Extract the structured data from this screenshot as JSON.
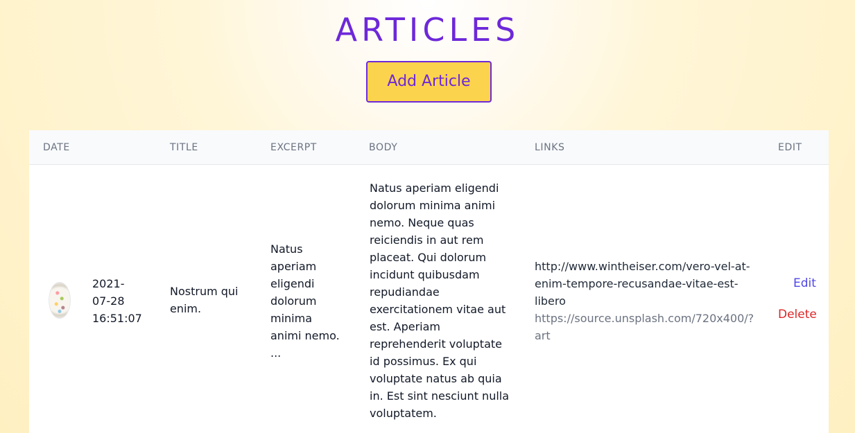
{
  "page": {
    "title": "ARTICLES",
    "add_button": "Add Article"
  },
  "table": {
    "headers": [
      "DATE",
      "TITLE",
      "EXCERPT",
      "BODY",
      "LINKS",
      "EDIT"
    ],
    "rows": [
      {
        "date": "2021-\n07-28\n16:51:07",
        "title": "Nostrum qui\nenim.",
        "excerpt": "Natus\naperiam\neligendi\ndolorum\nminima\nanimi nemo.\n...",
        "body": "Natus aperiam eligendi\ndolorum minima animi\nnemo. Neque quas\nreiciendis in aut rem\nplaceat. Qui dolorum\nincidunt quibusdam\nrepudiandae\nexercitationem vitae aut\nest. Aperiam\nreprehenderit voluptate\nid possimus. Ex qui\nvoluptate natus ab quia\nin. Est sint nesciunt nulla\nvoluptatem.",
        "link_url": "http://www.wintheiser.com/vero-vel-at-\nenim-tempore-recusandae-vitae-est-\nlibero",
        "image_url": "https://source.unsplash.com/720x400/?\nart",
        "edit_label": "Edit",
        "delete_label": "Delete"
      }
    ]
  },
  "colors": {
    "accent": "#6d28d9",
    "button_bg": "#fcd34d",
    "edit": "#4f46e5",
    "delete": "#dc2626"
  },
  "icons": {
    "thumbnail": "article-thumbnail-image"
  }
}
